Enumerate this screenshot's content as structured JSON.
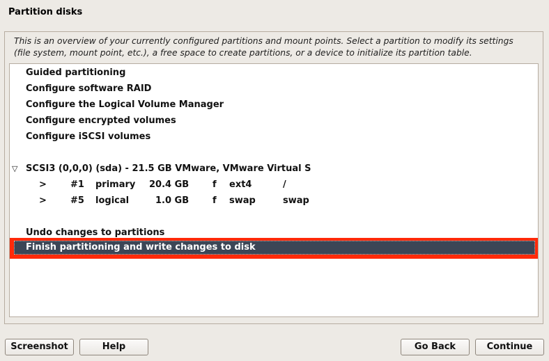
{
  "window": {
    "title": "Partition disks"
  },
  "description": {
    "line1": "This is an overview of your currently configured partitions and mount points. Select a partition to modify its settings",
    "line2": "(file system, mount point, etc.), a free space to create partitions, or a device to initialize its partition table."
  },
  "menu": {
    "items": [
      {
        "label": "Guided partitioning"
      },
      {
        "label": "Configure software RAID"
      },
      {
        "label": "Configure the Logical Volume Manager"
      },
      {
        "label": "Configure encrypted volumes"
      },
      {
        "label": "Configure iSCSI volumes"
      }
    ]
  },
  "disk": {
    "expander_icon": "triangle-down-icon",
    "expander_glyph": "▽",
    "label": "SCSI3 (0,0,0) (sda) - 21.5 GB VMware, VMware Virtual S",
    "partitions": [
      {
        "arrow": ">",
        "number": "#1",
        "type": "primary",
        "size": "20.4 GB",
        "flag": "f",
        "fs": "ext4",
        "mount": "/"
      },
      {
        "arrow": ">",
        "number": "#5",
        "type": "logical",
        "size": "1.0 GB",
        "flag": "f",
        "fs": "swap",
        "mount": "swap"
      }
    ]
  },
  "actions": {
    "undo": "Undo changes to partitions",
    "finish": "Finish partitioning and write changes to disk"
  },
  "buttons": {
    "screenshot": "Screenshot",
    "help": "Help",
    "go_back": "Go Back",
    "continue": "Continue"
  },
  "colors": {
    "selection_bg": "#3c4656",
    "highlight_border": "#ff2a0a",
    "window_bg": "#edeae5"
  }
}
